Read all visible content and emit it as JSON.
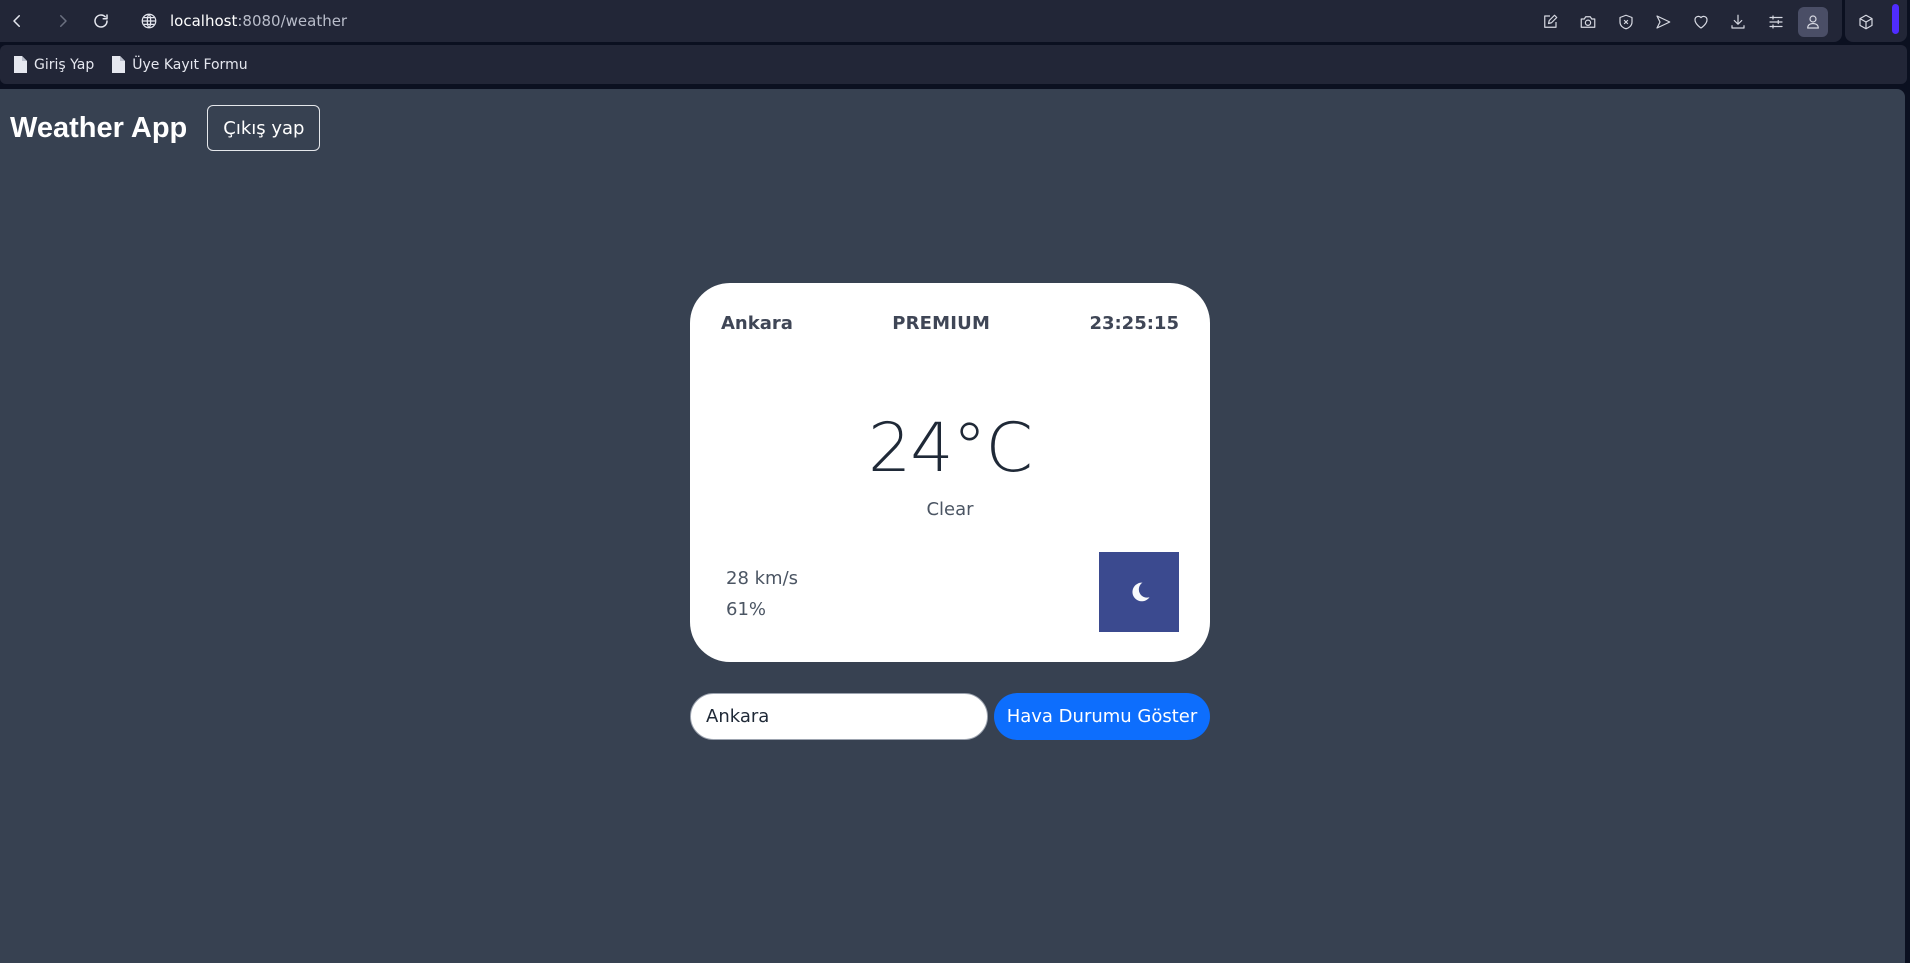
{
  "browser": {
    "url_host": "localhost",
    "url_path": ":8080/weather",
    "nav": {
      "back": "back-icon",
      "forward": "forward-icon",
      "reload": "reload-icon",
      "site_info": "globe-icon"
    },
    "toolbar_icons": [
      "edit-icon",
      "camera-icon",
      "shield-x-icon",
      "send-icon",
      "heart-icon",
      "download-icon",
      "sliders-icon",
      "profile-icon",
      "cube-icon"
    ],
    "bookmarks": [
      {
        "label": "Giriş Yap",
        "icon": "file-icon"
      },
      {
        "label": "Üye Kayıt Formu",
        "icon": "file-icon"
      }
    ],
    "accent": "#4f2cff"
  },
  "header": {
    "title": "Weather App",
    "logout_label": "Çıkış yap"
  },
  "card": {
    "city": "Ankara",
    "plan": "PREMIUM",
    "time": "23:25:15",
    "temperature": "24°C",
    "condition": "Clear",
    "wind": "28 km/s",
    "humidity": "61%",
    "icon": "moon-icon",
    "icon_bg": "#3b4a8f"
  },
  "search": {
    "input_value": "Ankara",
    "button_label": "Hava Durumu Göster",
    "button_color": "#0d6efd"
  },
  "colors": {
    "page_bg": "#374151",
    "chrome_bg": "#222637"
  }
}
